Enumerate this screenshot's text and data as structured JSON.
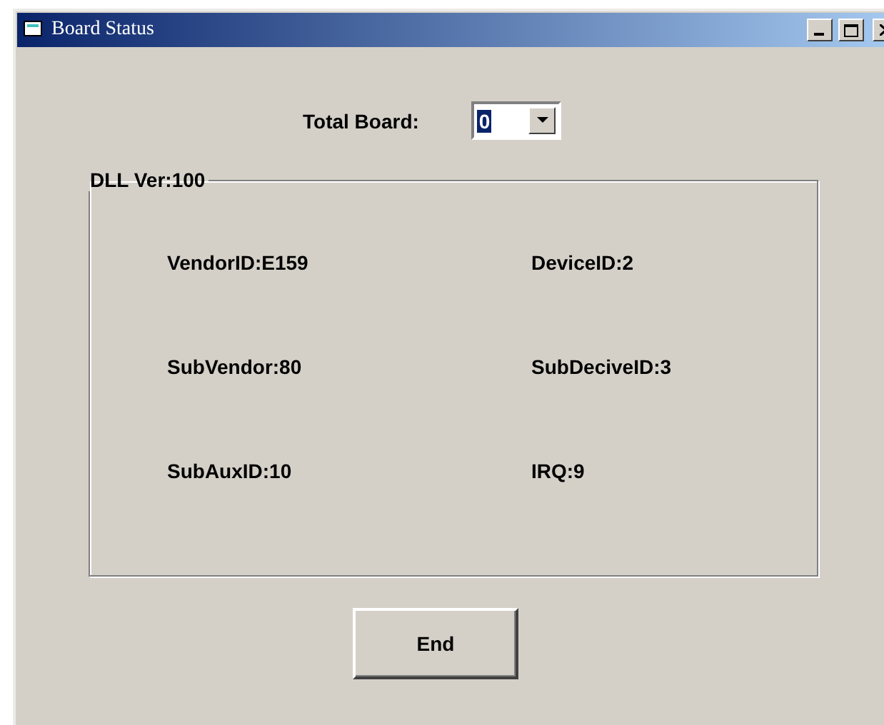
{
  "window": {
    "title": "Board Status"
  },
  "total_board": {
    "label": "Total Board:",
    "value": "0"
  },
  "group": {
    "caption": "DLL Ver:100",
    "fields": [
      {
        "text": "VendorID:E159"
      },
      {
        "text": "DeviceID:2"
      },
      {
        "text": "SubVendor:80"
      },
      {
        "text": "SubDeciveID:3"
      },
      {
        "text": "SubAuxID:10"
      },
      {
        "text": "IRQ:9"
      }
    ]
  },
  "buttons": [
    {
      "label": "End"
    }
  ]
}
